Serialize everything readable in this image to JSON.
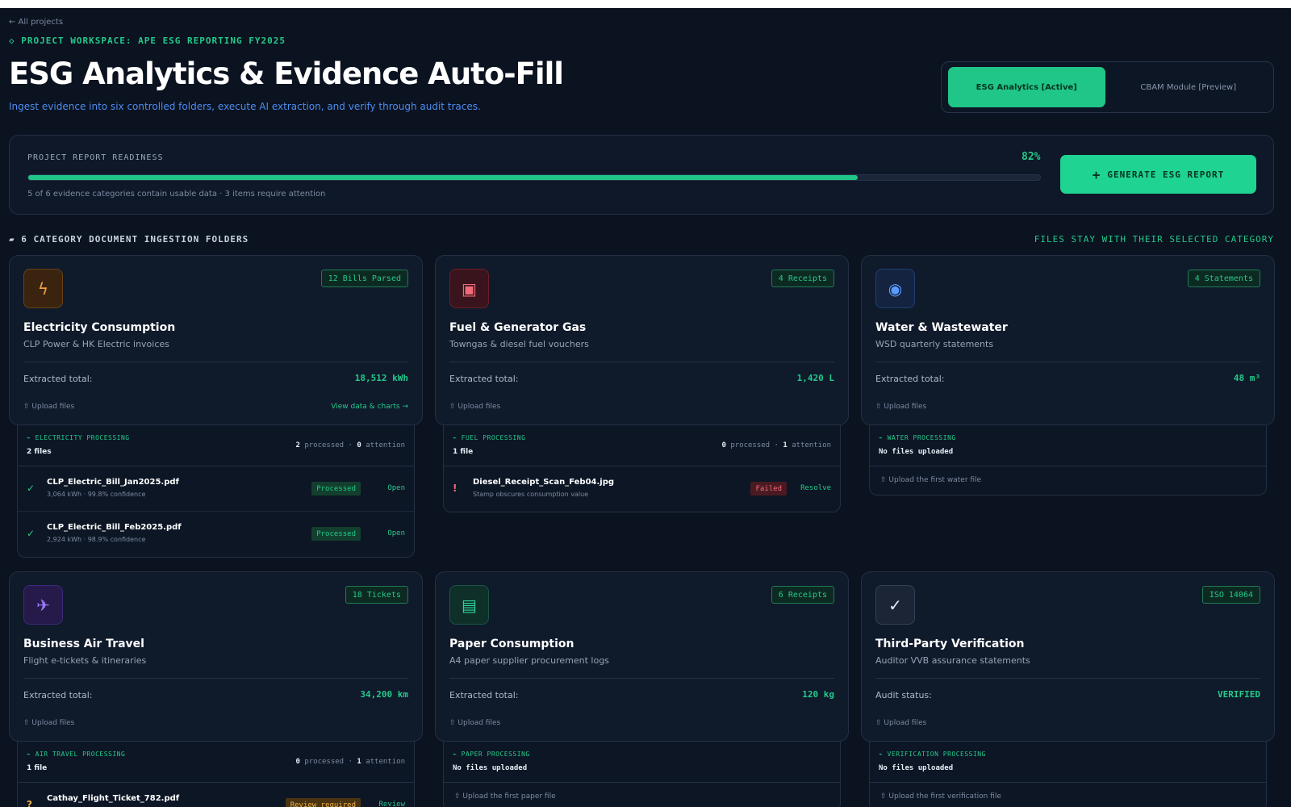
{
  "header": {
    "back_link": "← All projects",
    "kicker": "◇ PROJECT WORKSPACE: APE ESG REPORTING FY2025",
    "title": "ESG Analytics & Evidence Auto-Fill",
    "subtitle": "Ingest evidence into six controlled folders, execute AI extraction, and verify through audit traces."
  },
  "modules": [
    {
      "label": "ESG Analytics [Active]",
      "active": true
    },
    {
      "label": "CBAM Module [Preview]",
      "active": false
    }
  ],
  "readiness": {
    "label": "PROJECT REPORT READINESS",
    "percent_label": "82%",
    "percent": 82,
    "note": "5 of 6 evidence categories contain usable data · 3 items require attention",
    "button_label": "GENERATE ESG REPORT",
    "button_icon": "+"
  },
  "section": {
    "title": "▰ 6 CATEGORY DOCUMENT INGESTION FOLDERS",
    "right_note": "FILES STAY WITH THEIR SELECTED CATEGORY"
  },
  "categories": [
    {
      "icon": "ϟ",
      "icon_name": "lightning-icon",
      "icon_bg": "#3a2410",
      "icon_border": "#6b4216",
      "icon_color": "#f0a040",
      "badge": "12 Bills Parsed",
      "name": "Electricity Consumption",
      "desc": "CLP Power & HK Electric invoices",
      "total_label": "Extracted total:",
      "total_value": "18,512 kWh",
      "upload": "⇧ Upload files",
      "view": "View data & charts →",
      "panel": {
        "title": "⌁ ELECTRICITY PROCESSING",
        "count": "2 files",
        "processed": "2",
        "processed_label": "processed",
        "attention": "0",
        "attention_label": "attention",
        "files": [
          {
            "status": "✓",
            "name": "CLP_Electric_Bill_Jan2025.pdf",
            "meta": "3,064 kWh · 99.8% confidence",
            "badge": "Processed",
            "action": "Open"
          },
          {
            "status": "✓",
            "name": "CLP_Electric_Bill_Feb2025.pdf",
            "meta": "2,924 kWh · 98.9% confidence",
            "badge": "Processed",
            "action": "Open"
          }
        ]
      }
    },
    {
      "icon": "▣",
      "icon_name": "fuel-pump-icon",
      "icon_bg": "#3a141c",
      "icon_border": "#6b1e2b",
      "icon_color": "#f06b7a",
      "badge": "4 Receipts",
      "name": "Fuel & Generator Gas",
      "desc": "Towngas & diesel fuel vouchers",
      "total_label": "Extracted total:",
      "total_value": "1,420 L",
      "upload": "⇧ Upload files",
      "panel": {
        "title": "⌁ FUEL PROCESSING",
        "count": "1 file",
        "processed": "0",
        "processed_label": "processed",
        "attention": "1",
        "attention_label": "attention",
        "files": [
          {
            "status": "!",
            "name": "Diesel_Receipt_Scan_Feb04.jpg",
            "meta": "Stamp obscures consumption value",
            "badge": "Failed",
            "action": "Resolve"
          }
        ]
      }
    },
    {
      "icon": "◉",
      "icon_name": "water-drop-icon",
      "icon_bg": "#142440",
      "icon_border": "#1f3f73",
      "icon_color": "#5b9bff",
      "badge": "4 Statements",
      "name": "Water & Wastewater",
      "desc": "WSD quarterly statements",
      "total_label": "Extracted total:",
      "total_value": "48 m³",
      "upload": "⇧ Upload files",
      "panel": {
        "title": "⌁ WATER PROCESSING",
        "empty": "No files uploaded",
        "upload_first": "⇧ Upload the first water file"
      }
    },
    {
      "icon": "✈",
      "icon_name": "airplane-icon",
      "icon_bg": "#261a4a",
      "icon_border": "#3d2a78",
      "icon_color": "#9b7bff",
      "badge": "18 Tickets",
      "name": "Business Air Travel",
      "desc": "Flight e-tickets & itineraries",
      "total_label": "Extracted total:",
      "total_value": "34,200 km",
      "upload": "⇧ Upload files",
      "panel": {
        "title": "⌁ AIR TRAVEL PROCESSING",
        "count": "1 file",
        "processed": "0",
        "processed_label": "processed",
        "attention": "1",
        "attention_label": "attention",
        "files": [
          {
            "status": "?",
            "name": "Cathay_Flight_Ticket_782.pdf",
            "meta": "",
            "badge": "Review required",
            "action": "Review"
          }
        ]
      }
    },
    {
      "icon": "▤",
      "icon_name": "paper-stack-icon",
      "icon_bg": "#0f3028",
      "icon_border": "#1a5545",
      "icon_color": "#2fd49a",
      "badge": "6 Receipts",
      "name": "Paper Consumption",
      "desc": "A4 paper supplier procurement logs",
      "total_label": "Extracted total:",
      "total_value": "120 kg",
      "upload": "⇧ Upload files",
      "panel": {
        "title": "⌁ PAPER PROCESSING",
        "empty": "No files uploaded",
        "upload_first": "⇧ Upload the first paper file"
      }
    },
    {
      "icon": "✓",
      "icon_name": "checkmark-icon",
      "icon_bg": "#1b2535",
      "icon_border": "#334259",
      "icon_color": "#e6edf5",
      "badge": "ISO 14064",
      "name": "Third-Party Verification",
      "desc": "Auditor VVB assurance statements",
      "total_label": "Audit status:",
      "total_value": "VERIFIED",
      "upload": "⇧ Upload files",
      "panel": {
        "title": "⌁ VERIFICATION PROCESSING",
        "empty": "No files uploaded",
        "upload_first": "⇧ Upload the first verification file"
      }
    }
  ]
}
